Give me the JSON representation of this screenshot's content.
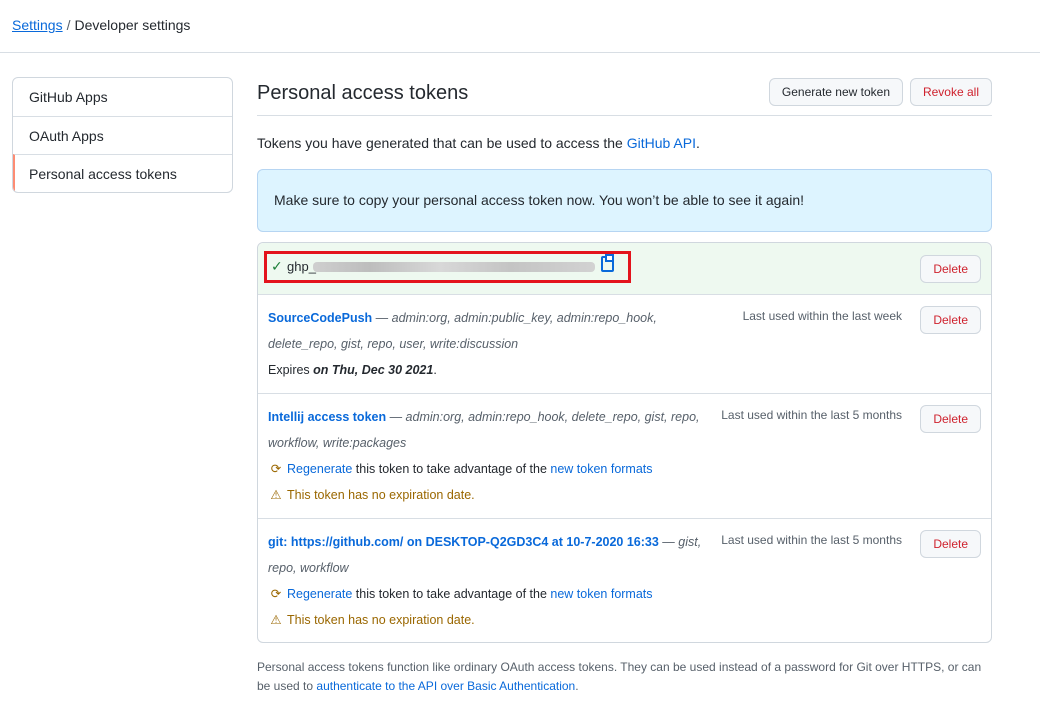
{
  "breadcrumb": {
    "root": "Settings",
    "separator": "/",
    "current": "Developer settings"
  },
  "sidebar": {
    "items": [
      {
        "label": "GitHub Apps"
      },
      {
        "label": "OAuth Apps"
      },
      {
        "label": "Personal access tokens"
      }
    ]
  },
  "header": {
    "title": "Personal access tokens",
    "generate_label": "Generate new token",
    "revoke_label": "Revoke all"
  },
  "intro": {
    "text": "Tokens you have generated that can be used to access the ",
    "link": "GitHub API",
    "suffix": "."
  },
  "flash": {
    "text": "Make sure to copy your personal access token now. You won’t be able to see it again!"
  },
  "new_token": {
    "prefix": "ghp_",
    "delete_label": "Delete"
  },
  "tokens": [
    {
      "name": "SourceCodePush",
      "scopes": " — admin:org, admin:public_key, admin:repo_hook, delete_repo, gist, repo, user, write:discussion",
      "last_used": "Last used within the last week",
      "expires_prefix": "Expires ",
      "expires_date": "on Thu, Dec 30 2021",
      "expires_suffix": ".",
      "delete_label": "Delete"
    },
    {
      "name": "Intellij access token",
      "scopes": " — admin:org, admin:repo_hook, delete_repo, gist, repo, workflow, write:packages",
      "last_used": "Last used within the last 5 months",
      "regen_link": "Regenerate",
      "regen_text": " this token to take advantage of the ",
      "regen_link2": "new token formats",
      "warning": "This token has no expiration date.",
      "delete_label": "Delete"
    },
    {
      "name": "git: https://github.com/ on DESKTOP-Q2GD3C4 at 10-7-2020 16:33",
      "scopes": " — gist, repo, workflow",
      "last_used": "Last used within the last 5 months",
      "regen_link": "Regenerate",
      "regen_text": " this token to take advantage of the ",
      "regen_link2": "new token formats",
      "warning": "This token has no expiration date.",
      "delete_label": "Delete"
    }
  ],
  "footer": {
    "text": "Personal access tokens function like ordinary OAuth access tokens. They can be used instead of a password for Git over HTTPS, or can be used to ",
    "link": "authenticate to the API over Basic Authentication",
    "suffix": "."
  },
  "colors": {
    "accent": "#0969da",
    "danger": "#cf222e",
    "warning": "#9a6700",
    "success": "#1a7f37",
    "highlight_box": "#e3131c"
  }
}
